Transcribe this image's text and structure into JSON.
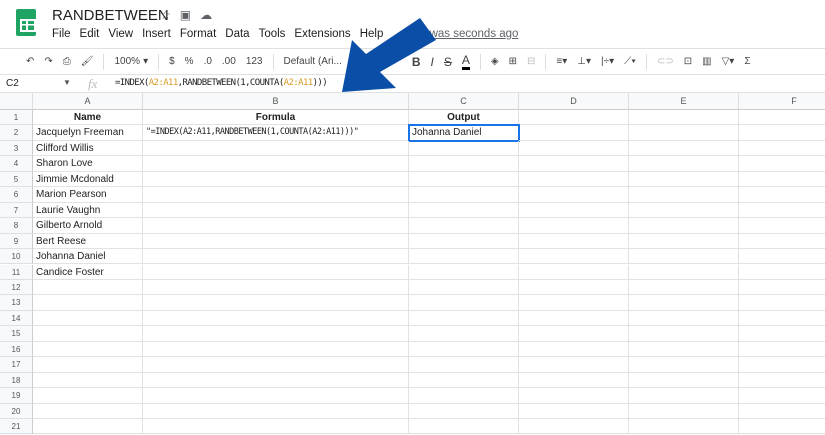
{
  "app": {
    "title": "RANDBETWEEN",
    "saved_status": "It was seconds ago",
    "menu": [
      "File",
      "Edit",
      "View",
      "Insert",
      "Format",
      "Data",
      "Tools",
      "Extensions",
      "Help"
    ]
  },
  "toolbar": {
    "zoom": "100%",
    "currency": "$",
    "percent": "%",
    "dec_less": ".0",
    "dec_more": ".00",
    "format": "123",
    "font": "Default (Ari...",
    "bold": "B",
    "italic": "I",
    "strike": "S",
    "text_color": "A"
  },
  "formula_bar": {
    "cell_ref": "C2",
    "fx": "fx",
    "parts": [
      "=INDEX(",
      "A2:A11",
      ",RANDBETWEEN(1,COUNTA(",
      "A2:A11",
      ")))"
    ]
  },
  "columns": [
    "A",
    "B",
    "C",
    "D",
    "E",
    "F"
  ],
  "rows": [
    "1",
    "2",
    "3",
    "4",
    "5",
    "6",
    "7",
    "8",
    "9",
    "10",
    "11",
    "12",
    "13",
    "14",
    "15",
    "16",
    "17",
    "18",
    "19",
    "20",
    "21"
  ],
  "headers": {
    "name": "Name",
    "formula": "Formula",
    "output": "Output"
  },
  "names": [
    "Jacquelyn Freeman",
    "Clifford Willis",
    "Sharon Love",
    "Jimmie Mcdonald",
    "Marion Pearson",
    "Laurie Vaughn",
    "Gilberto Arnold",
    "Bert Reese",
    "Johanna Daniel",
    "Candice Foster"
  ],
  "formula_text": "\"=INDEX(A2:A11,RANDBETWEEN(1,COUNTA(A2:A11)))\"",
  "output": "Johanna Daniel",
  "colors": {
    "arrow": "#0a4ea8",
    "selection": "#1a73e8"
  }
}
